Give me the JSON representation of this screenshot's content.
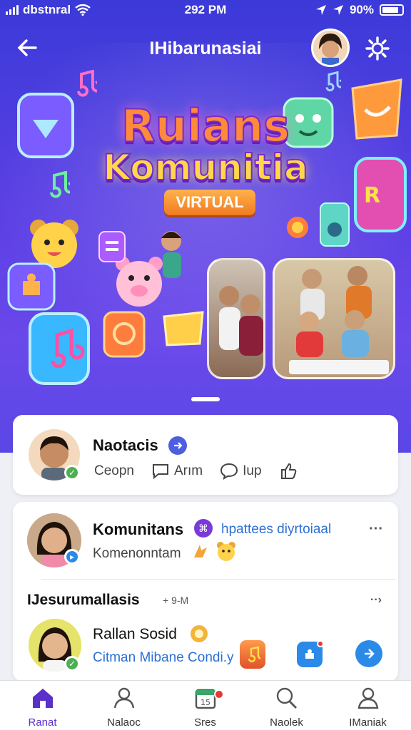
{
  "status_bar": {
    "carrier": "dbstnral",
    "time": "292 PM",
    "battery": "90%"
  },
  "header": {
    "title": "IHibarunasiai"
  },
  "hero": {
    "headline_1": "Ruians",
    "headline_2": "Komunitia",
    "badge": "VIRTUAL"
  },
  "post_card": {
    "name": "Naotacis",
    "actions": [
      {
        "label": "Ceopn"
      },
      {
        "label": "Arım"
      },
      {
        "label": "Iup"
      }
    ]
  },
  "community_card": {
    "name": "Komunitans",
    "link": "hpattees diyrtoiaal",
    "subtitle": "Komenonntam",
    "section_title": "IJesurumallasis",
    "section_meta": "+ 9-M",
    "member_name": "Rallan Sosid",
    "member_subtitle": "Citman Mibane Condi.y"
  },
  "tabs": [
    {
      "label": "Ranat",
      "icon": "home-icon",
      "active": true
    },
    {
      "label": "Nalaoc",
      "icon": "people-icon",
      "active": false
    },
    {
      "label": "Sres",
      "icon": "calendar-icon",
      "active": false
    },
    {
      "label": "Naolek",
      "icon": "search-icon",
      "active": false
    },
    {
      "label": "IManiak",
      "icon": "profile-icon",
      "active": false
    }
  ],
  "colors": {
    "hero_start": "#3b3ad8",
    "hero_end": "#6a48ea",
    "accent": "#5b2fc9",
    "link": "#2c6fd6",
    "online": "#4caf50"
  }
}
